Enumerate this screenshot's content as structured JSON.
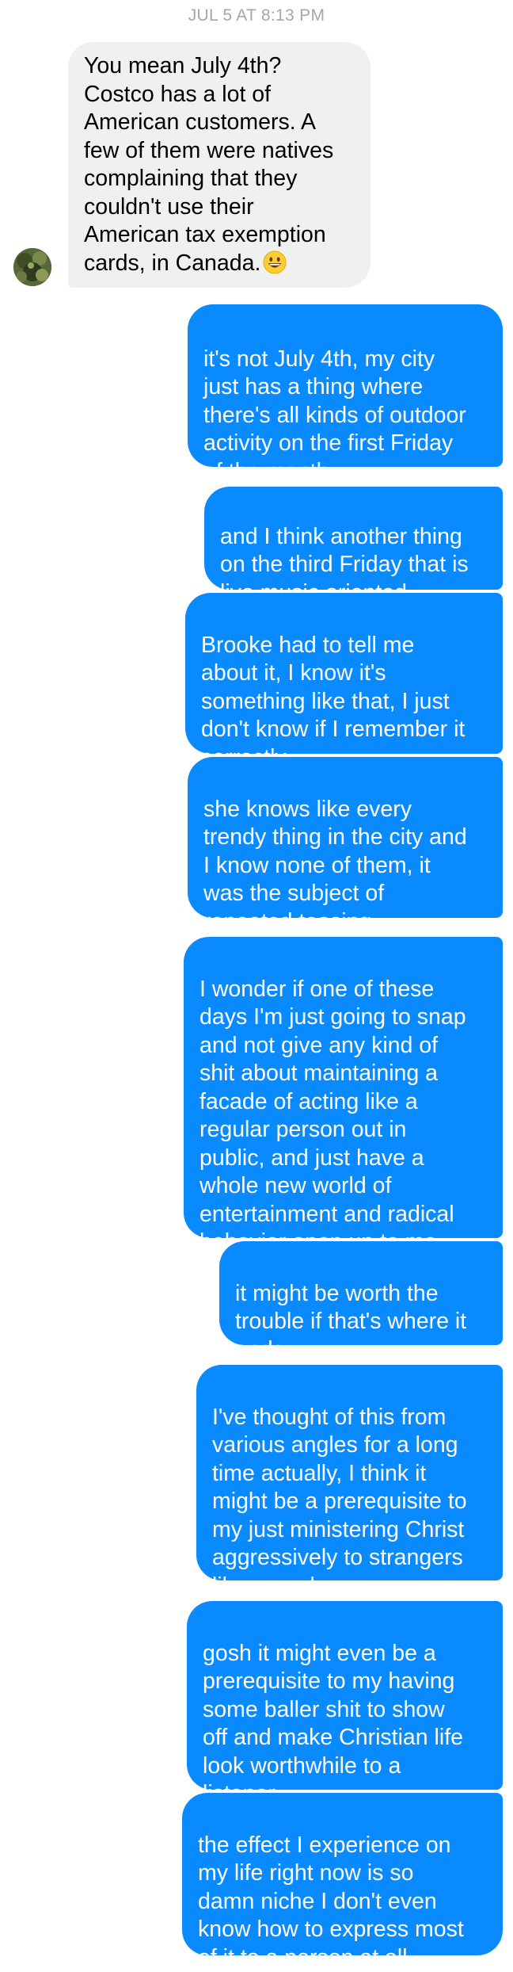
{
  "conversation": {
    "timestamp": "JUL 5 AT 8:13 PM",
    "incoming": {
      "text": "You mean July 4th?\nCostco has a lot of\nAmerican customers. A\nfew of them were natives\ncomplaining that they\ncouldn't use their\nAmerican tax exemption\ncards, in Canada.",
      "emoji": "grinning-face-emoji"
    },
    "outgoing": [
      {
        "text": "it's not July 4th, my city\njust has a thing where\nthere's all kinds of outdoor\nactivity on the first Friday\nof the month"
      },
      {
        "text": "and I think another thing\non the third Friday that is\nlive music oriented"
      },
      {
        "text": "Brooke had to tell me\nabout it, I know it's\nsomething like that, I just\ndon't know if I remember it\ncorrectly"
      },
      {
        "text": "she knows like every\ntrendy thing in the city and\nI know none of them, it\nwas the subject of\nrepeated teasing"
      },
      {
        "text": "I wonder if one of these\ndays I'm just going to snap\nand not give any kind of\nshit about maintaining a\nfacade of acting like a\nregular person out in\npublic, and just have a\nwhole new world of\nentertainment and radical\nbehavior open up to me"
      },
      {
        "text": "it might be worth the\ntrouble if that's where it\nends"
      },
      {
        "text": "I've thought of this from\nvarious angles for a long\ntime actually, I think it\nmight be a prerequisite to\nmy just ministering Christ\naggressively to strangers\nlike a madman"
      },
      {
        "text": "gosh it might even be a\nprerequisite to my having\nsome baller shit to show\noff and make Christian life\nlook worthwhile to a\nlistener"
      },
      {
        "text": "the effect I experience on\nmy life right now is so\ndamn niche I don't even\nknow how to express most\nof it to a person at all"
      }
    ]
  }
}
